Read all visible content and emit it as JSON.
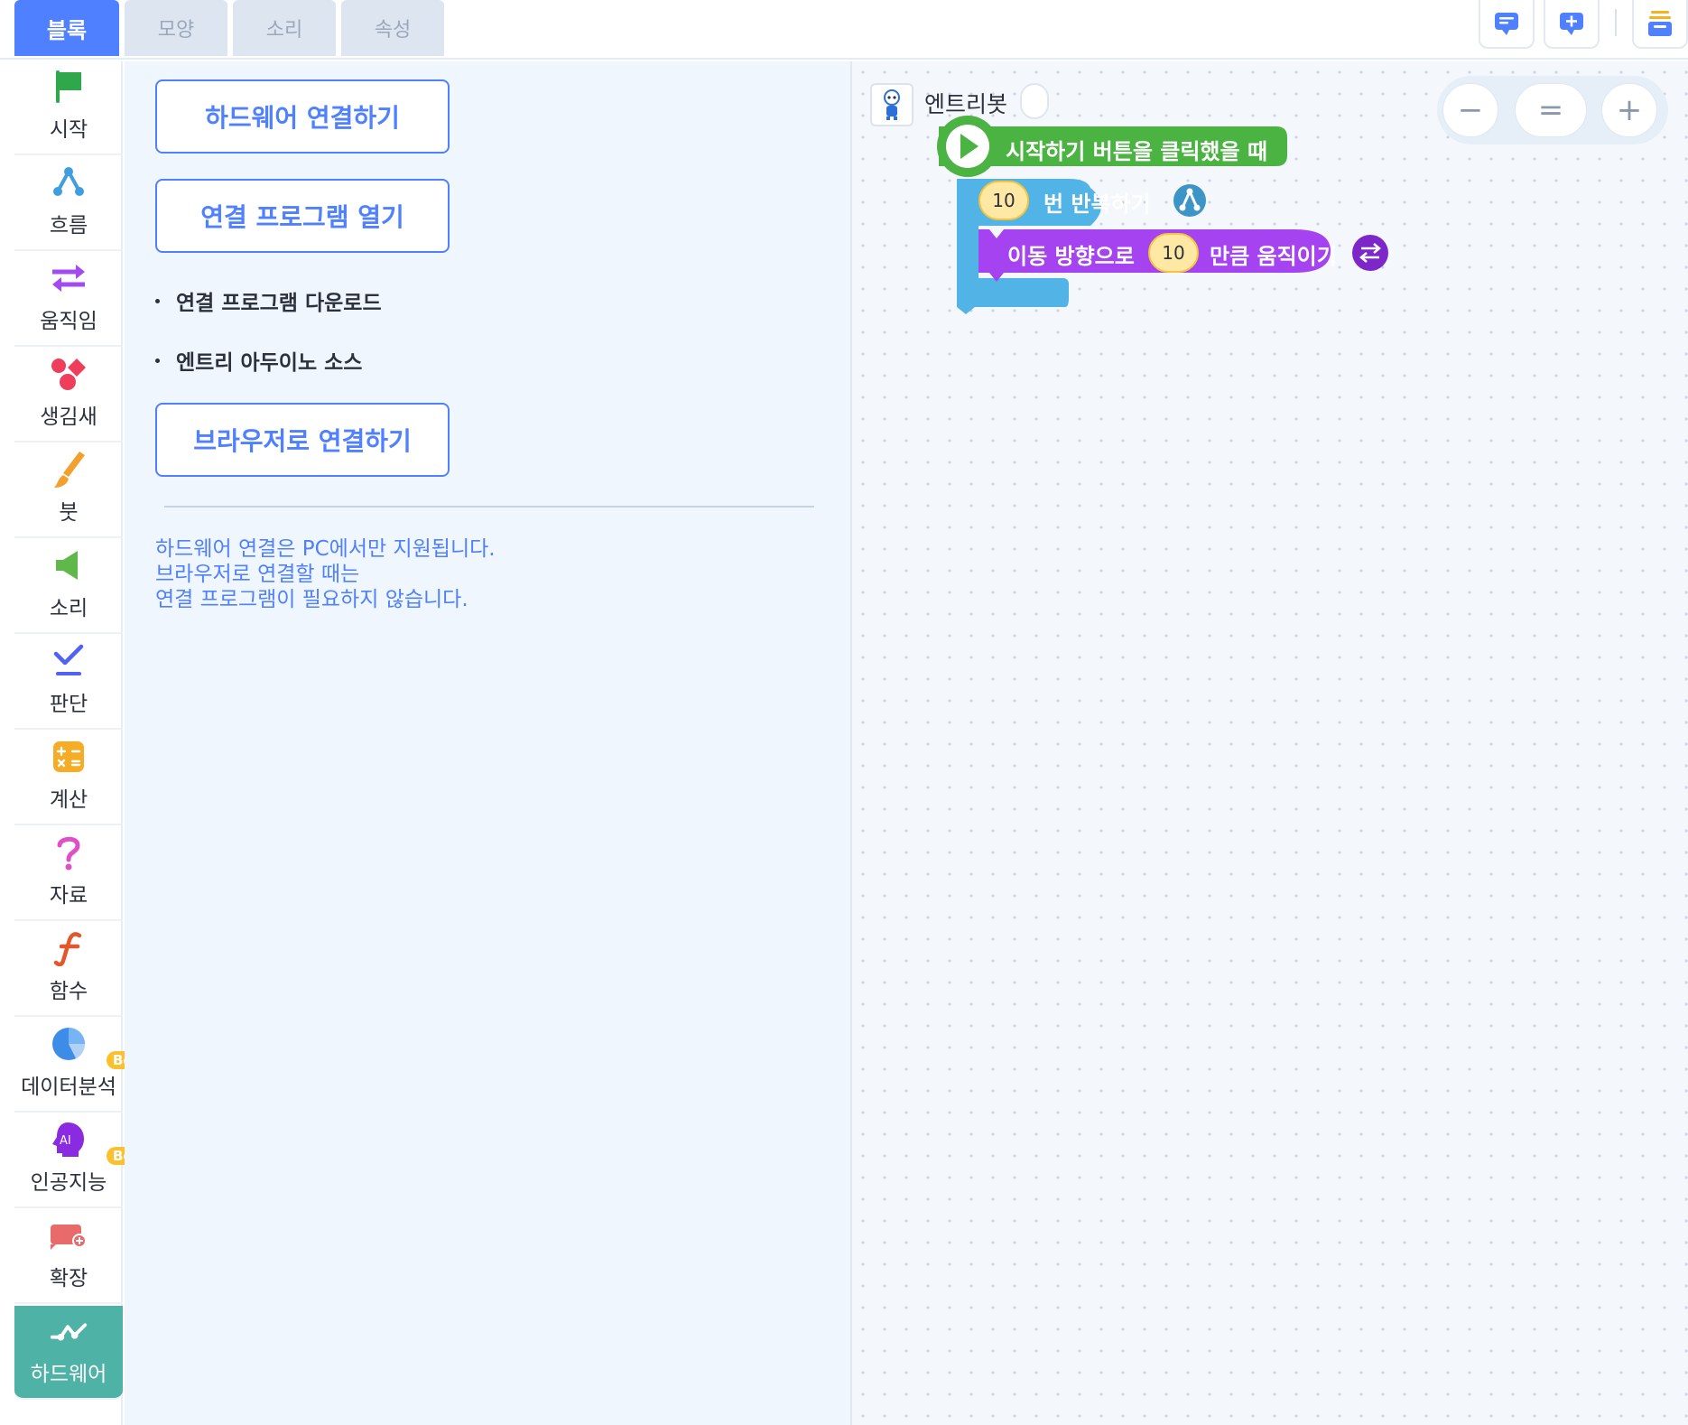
{
  "tabs": [
    {
      "label": "블록",
      "active": true
    },
    {
      "label": "모양",
      "active": false
    },
    {
      "label": "소리",
      "active": false
    },
    {
      "label": "속성",
      "active": false
    }
  ],
  "categories": [
    {
      "label": "시작",
      "icon": "flag-icon",
      "color": "#2ea84a"
    },
    {
      "label": "흐름",
      "icon": "flow-icon",
      "color": "#3f9de0"
    },
    {
      "label": "움직임",
      "icon": "arrows-icon",
      "color": "#a24bef"
    },
    {
      "label": "생김새",
      "icon": "shapes-icon",
      "color": "#ef3e5c"
    },
    {
      "label": "붓",
      "icon": "brush-icon",
      "color": "#f4a02e"
    },
    {
      "label": "소리",
      "icon": "speaker-icon",
      "color": "#5fb849"
    },
    {
      "label": "판단",
      "icon": "check-icon",
      "color": "#5062f2"
    },
    {
      "label": "계산",
      "icon": "calculator-icon",
      "color": "#f6ac25"
    },
    {
      "label": "자료",
      "icon": "question-icon",
      "color": "#e04fc5"
    },
    {
      "label": "함수",
      "icon": "function-icon",
      "color": "#e2582c"
    },
    {
      "label": "데이터분석",
      "icon": "pie-chart-icon",
      "color": "#3d8de8",
      "badge": "Beta"
    },
    {
      "label": "인공지능",
      "icon": "ai-head-icon",
      "color": "#8a2be2",
      "badge": "Beta"
    },
    {
      "label": "확장",
      "icon": "extension-icon",
      "color": "#e86a6a"
    },
    {
      "label": "하드웨어",
      "icon": "hardware-icon",
      "color": "#ffffff",
      "active": true
    }
  ],
  "hardware": {
    "connect_button": "하드웨어 연결하기",
    "open_program_button": "연결 프로그램 열기",
    "download_link": "연결 프로그램 다운로드",
    "arduino_source_link": "엔트리 아두이노 소스",
    "browser_connect_button": "브라우저로 연결하기",
    "note_lines": [
      "하드웨어 연결은 PC에서만 지원됩니다.",
      "브라우저로 연결할 때는",
      "연결 프로그램이 필요하지 않습니다."
    ]
  },
  "workspace": {
    "object_name": "엔트리봇",
    "zoom": {
      "out": "−",
      "reset": "=",
      "in": "+"
    },
    "blocks": {
      "start": {
        "label": "시작하기 버튼을 클릭했을 때",
        "color": "#4bb341"
      },
      "repeat": {
        "count": "10",
        "label": "번 반복하기",
        "color": "#52b4e6"
      },
      "move": {
        "prefix": "이동 방향으로",
        "value": "10",
        "suffix": "만큼 움직이기",
        "color": "#a543f0"
      }
    }
  },
  "colors": {
    "accent": "#4f80ff",
    "hardware_active": "#4eb2a6"
  }
}
